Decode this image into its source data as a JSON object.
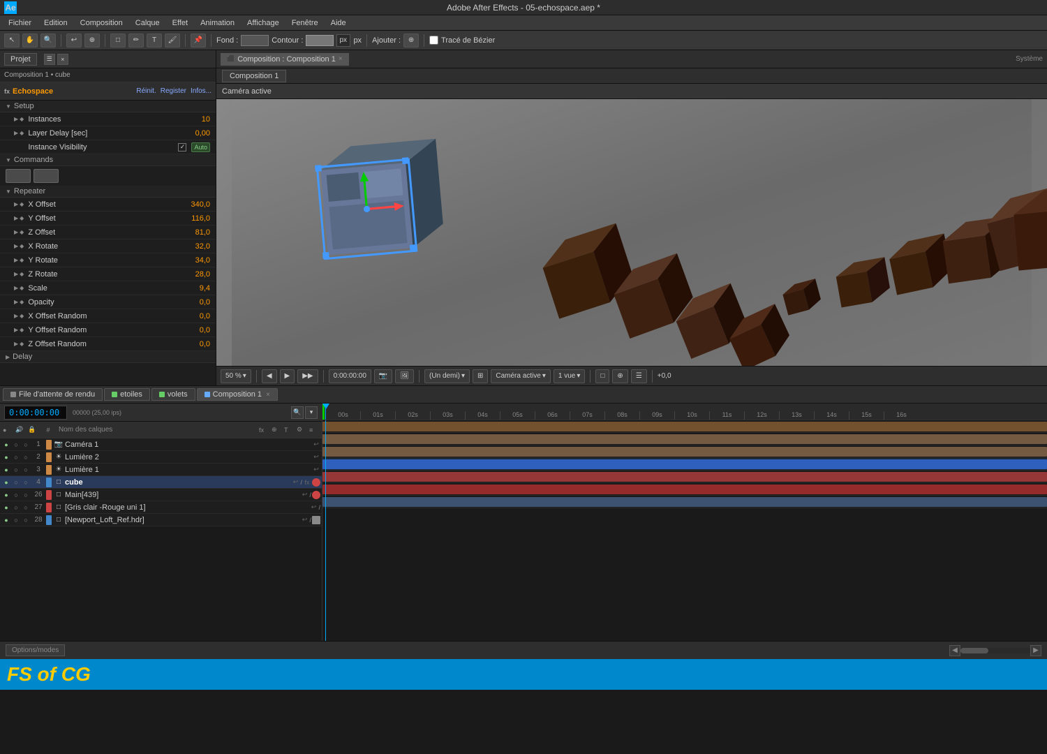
{
  "app": {
    "title": "Adobe After Effects - 05-echospace.aep *",
    "icon_label": "Ae"
  },
  "menu": {
    "items": [
      "Fichier",
      "Edition",
      "Composition",
      "Calque",
      "Effet",
      "Animation",
      "Affichage",
      "Fenêtre",
      "Aide"
    ]
  },
  "toolbar": {
    "fond_label": "Fond :",
    "contour_label": "Contour :",
    "px_label": "px",
    "ajouter_label": "Ajouter :",
    "trace_bezier": "Tracé de Bézier"
  },
  "project_panel": {
    "tab_label": "Projet",
    "breadcrumb": "Composition 1 • cube",
    "effect_name": "Echospace",
    "effect_btns": [
      "Réinit.",
      "Register",
      "Infos..."
    ],
    "setup_section": "Setup",
    "instances_label": "Instances",
    "instances_value": "10",
    "layer_delay_label": "Layer Delay [sec]",
    "layer_delay_value": "0,00",
    "instance_vis_label": "Instance Visibility",
    "instance_vis_value": "Auto",
    "commands_label": "Commands",
    "repeater_label": "Repeater",
    "x_offset_label": "X Offset",
    "x_offset_value": "340,0",
    "y_offset_label": "Y Offset",
    "y_offset_value": "116,0",
    "z_offset_label": "Z Offset",
    "z_offset_value": "81,0",
    "x_rotate_label": "X Rotate",
    "x_rotate_value": "32,0",
    "y_rotate_label": "Y Rotate",
    "y_rotate_value": "34,0",
    "z_rotate_label": "Z Rotate",
    "z_rotate_value": "28,0",
    "scale_label": "Scale",
    "scale_value": "9,4",
    "opacity_label": "Opacity",
    "opacity_value": "0,0",
    "x_offset_random_label": "X Offset Random",
    "x_offset_random_value": "0,0",
    "y_offset_random_label": "Y Offset Random",
    "y_offset_random_value": "0,0",
    "z_offset_random_label": "Z Offset Random",
    "z_offset_random_value": "0,0",
    "delay_label": "Delay"
  },
  "composition_viewer": {
    "tab_label": "Composition : Composition 1",
    "comp_name": "Composition 1",
    "active_camera": "Caméra active",
    "system_label": "Système"
  },
  "viewer_toolbar": {
    "zoom": "50 %",
    "time": "0:00:00:00",
    "quality": "(Un demi)",
    "camera": "Caméra active",
    "views": "1 vue",
    "offset_val": "+0,0"
  },
  "bottom_tabs": [
    {
      "label": "File d'attente de rendu",
      "color": "#888888"
    },
    {
      "label": "etoiles",
      "color": "#66cc66"
    },
    {
      "label": "volets",
      "color": "#66cc66"
    },
    {
      "label": "Composition 1",
      "color": "#66aaff",
      "active": true
    }
  ],
  "timeline_controls": {
    "time_display": "0:00:00:00",
    "fps_label": "00000 (25,00 ips)"
  },
  "layers": [
    {
      "num": "1",
      "name": "Caméra 1",
      "color": "#cc8844",
      "icon": "📷",
      "type": "camera"
    },
    {
      "num": "2",
      "name": "Lumière 2",
      "color": "#cc8844",
      "icon": "☀",
      "type": "light"
    },
    {
      "num": "3",
      "name": "Lumière 1",
      "color": "#cc8844",
      "icon": "☀",
      "type": "light"
    },
    {
      "num": "4",
      "name": "cube",
      "color": "#4488cc",
      "icon": "□",
      "type": "comp",
      "selected": true
    },
    {
      "num": "26",
      "name": "Main[439]",
      "color": "#cc4444",
      "icon": "□",
      "type": "comp"
    },
    {
      "num": "27",
      "name": "[Gris clair -Rouge uni 1]",
      "color": "#cc4444",
      "icon": "□",
      "type": "comp"
    },
    {
      "num": "28",
      "name": "[Newport_Loft_Ref.hdr]",
      "color": "#4488cc",
      "icon": "□",
      "type": "comp"
    }
  ],
  "timeline": {
    "ruler_marks": [
      "00s",
      "01s",
      "02s",
      "03s",
      "04s",
      "05s",
      "06s",
      "07s",
      "08s",
      "09s",
      "10s",
      "11s",
      "12s",
      "13s",
      "14s",
      "15s",
      "16s"
    ],
    "playhead_pos": "0"
  },
  "track_colors": [
    "#cc8844",
    "#cc9966",
    "#cc9966",
    "#4488ee",
    "#dd4444",
    "#cc3333",
    "#6688aa"
  ],
  "watermark": {
    "text": "FS of CG"
  },
  "status_bar": {
    "options_label": "Options/modes"
  }
}
